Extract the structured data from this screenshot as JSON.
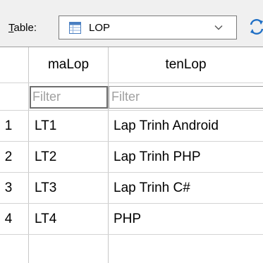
{
  "toolbar": {
    "table_label_u": "T",
    "table_label_rest": "able:",
    "selected_table": "LOP",
    "table_icon": "table-icon",
    "dropdown_icon": "chevron-down-icon",
    "refresh_icon": "refresh-icon"
  },
  "grid": {
    "columns": [
      {
        "header": "maLop",
        "filter_placeholder": "Filter"
      },
      {
        "header": "tenLop",
        "filter_placeholder": "Filter"
      }
    ],
    "rows": [
      {
        "num": "1",
        "maLop": "LT1",
        "tenLop": "Lap Trinh Android"
      },
      {
        "num": "2",
        "maLop": "LT2",
        "tenLop": "Lap Trinh PHP"
      },
      {
        "num": "3",
        "maLop": "LT3",
        "tenLop": "Lap Trinh C#"
      },
      {
        "num": "4",
        "maLop": "LT4",
        "tenLop": "PHP"
      }
    ]
  },
  "colors": {
    "background": "#f0f0f0",
    "grid_background": "#ffffff",
    "refresh_icon": "#1f6fc5"
  }
}
